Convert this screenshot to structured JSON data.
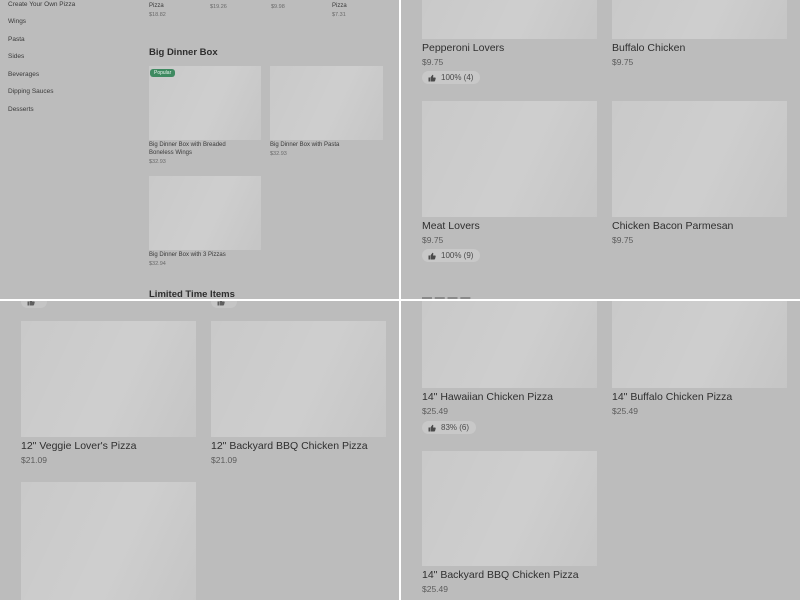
{
  "desktop": {
    "sidebar": [
      "Create Your Own Pizza",
      "Wings",
      "Pasta",
      "Sides",
      "Beverages",
      "Dipping Sauces",
      "Desserts"
    ],
    "top_row": [
      {
        "name": "Pizza",
        "price": "$18.82"
      },
      {
        "name": "",
        "price": "$19.26"
      },
      {
        "name": "",
        "price": "$9.98"
      },
      {
        "name": "Pizza",
        "price": "$7.31"
      }
    ],
    "big_dinner_box": {
      "title": "Big Dinner Box",
      "badge": "Popular",
      "items": [
        {
          "name": "Big Dinner Box with Breaded Boneless Wings",
          "price": "$32.93"
        },
        {
          "name": "Big Dinner Box with Pasta",
          "price": "$32.93"
        },
        {
          "name": "Big Dinner Box with 3 Pizzas",
          "price": "$32.94"
        }
      ]
    },
    "limited_title": "Limited Time Items"
  },
  "mobile_top": {
    "items": [
      {
        "name": "Pepperoni Lovers",
        "price": "$9.75",
        "rating": "100% (4)"
      },
      {
        "name": "Buffalo Chicken",
        "price": "$9.75",
        "rating": ""
      },
      {
        "name": "Meat Lovers",
        "price": "$9.75",
        "rating": "100% (9)"
      },
      {
        "name": "Chicken Bacon Parmesan",
        "price": "$9.75",
        "rating": ""
      }
    ]
  },
  "mobile_left": {
    "items": [
      {
        "name": "12\" Veggie Lover's Pizza",
        "price": "$21.09"
      },
      {
        "name": "12\" Backyard BBQ Chicken Pizza",
        "price": "$21.09"
      }
    ]
  },
  "mobile_right": {
    "items": [
      {
        "name": "14\" Hawaiian Chicken Pizza",
        "price": "$25.49",
        "rating": "83% (6)"
      },
      {
        "name": "14\" Buffalo Chicken Pizza",
        "price": "$25.49",
        "rating": ""
      },
      {
        "name": "14\" Backyard BBQ Chicken Pizza",
        "price": "$25.49",
        "rating": ""
      }
    ]
  },
  "colors": {
    "overlay": "#bcbcbc",
    "image": "#c9c9c9",
    "badge": "#3f8a61",
    "divider": "#ffffff"
  },
  "icons": {
    "rating": "thumbs-up-icon"
  }
}
